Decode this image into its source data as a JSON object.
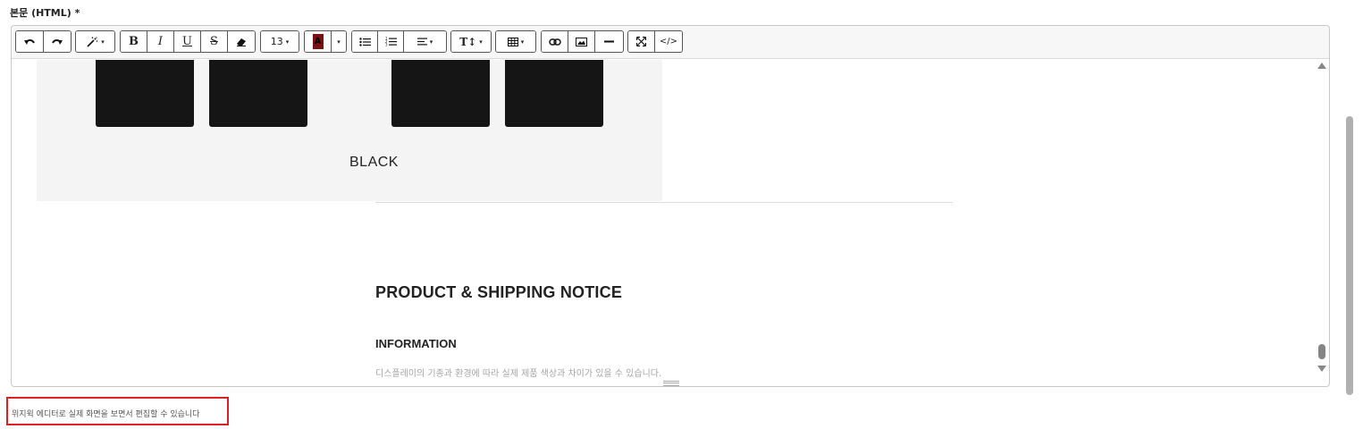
{
  "field": {
    "label": "본문 (HTML) *",
    "hint": "위지윅 에디터로 실제 화면을 보면서 편집할 수 있습니다"
  },
  "toolbar": {
    "font_size": "13",
    "bold": "B",
    "italic": "I",
    "underline": "U",
    "strike": "S",
    "text_size_glyph": "T↕",
    "code_view": "</>",
    "caret": "▾",
    "color_letter": "A",
    "color_swatch": "#7a1010"
  },
  "content": {
    "image_caption": "BLACK",
    "notice_title": "PRODUCT & SHIPPING NOTICE",
    "info_title": "INFORMATION",
    "info_text": "디스플레이의 기종과 환경에 따라 실제 제품 색상과 차이가 있을 수 있습니다."
  },
  "icons": [
    "undo-icon",
    "redo-icon",
    "magic-wand-icon",
    "eraser-icon",
    "unordered-list-icon",
    "ordered-list-icon",
    "align-icon",
    "table-icon",
    "link-icon",
    "picture-icon",
    "horizontal-rule-icon",
    "fullscreen-icon",
    "code-view-icon"
  ],
  "colors": {
    "hint_border": "#e02020",
    "swatch": "#7a1010"
  }
}
